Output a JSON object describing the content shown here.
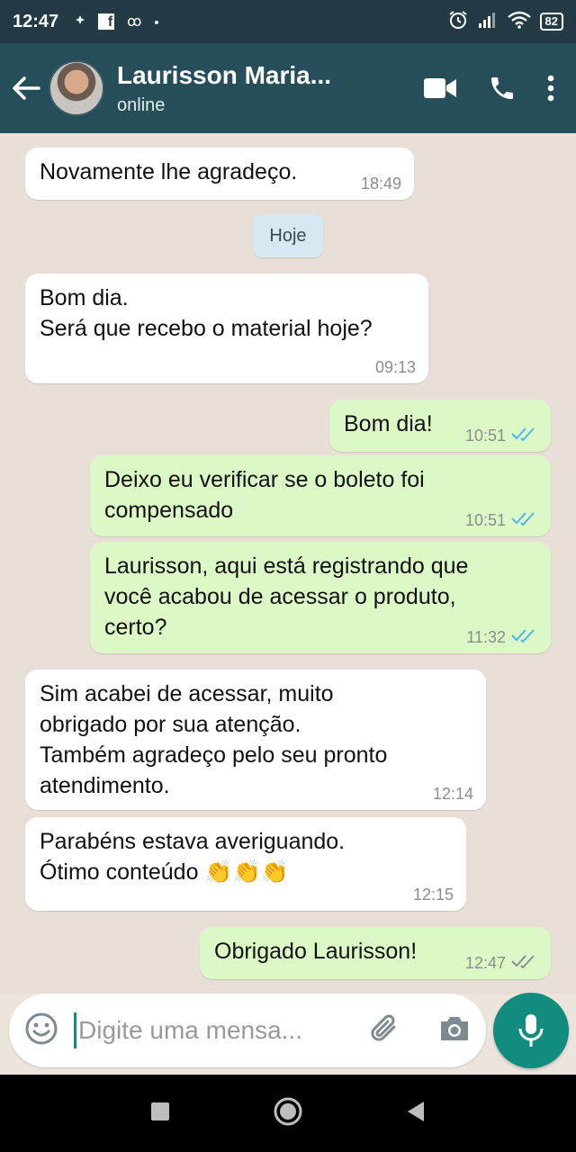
{
  "status_bar": {
    "time": "12:47",
    "facebook_glyph": "f",
    "voicemail_glyph": "ꝏ",
    "battery": "82",
    "icons": [
      "notification-dot-icon",
      "facebook-icon",
      "voicemail-icon",
      "alarm-icon",
      "signal-icon",
      "wifi-icon",
      "battery-icon"
    ]
  },
  "header": {
    "contact_name": "Laurisson Maria...",
    "contact_status": "online",
    "icons": [
      "back-arrow-icon",
      "avatar",
      "video-call-icon",
      "phone-call-icon",
      "more-options-icon"
    ]
  },
  "date_divider": "Hoje",
  "messages": [
    {
      "direction": "in",
      "lines": [
        "Novamente lhe agradeço."
      ],
      "time": "18:49",
      "read": false
    },
    {
      "direction": "in",
      "lines": [
        "Bom dia.",
        "Será que recebo o material hoje?"
      ],
      "time": "09:13",
      "read": false
    },
    {
      "direction": "out",
      "lines": [
        "Bom dia!"
      ],
      "time": "10:51",
      "read": true
    },
    {
      "direction": "out",
      "lines": [
        "Deixo eu verificar se o boleto foi",
        "compensado"
      ],
      "time": "10:51",
      "read": true
    },
    {
      "direction": "out",
      "lines": [
        "Laurisson, aqui está registrando que",
        "você acabou de acessar o produto,",
        "certo?"
      ],
      "time": "11:32",
      "read": true
    },
    {
      "direction": "in",
      "lines": [
        "Sim acabei de acessar, muito",
        "obrigado por sua atenção.",
        "Também agradeço pelo seu pronto",
        "atendimento."
      ],
      "time": "12:14",
      "read": false
    },
    {
      "direction": "in",
      "lines": [
        "Parabéns estava averiguando.",
        "Ótimo conteúdo 👏👏👏"
      ],
      "time": "12:15",
      "read": false
    },
    {
      "direction": "out",
      "lines": [
        "Obrigado Laurisson!"
      ],
      "time": "12:47",
      "read": false
    }
  ],
  "input": {
    "placeholder": "Digite uma mensa...",
    "icons": [
      "emoji-icon",
      "attach-icon",
      "camera-icon",
      "microphone-icon"
    ]
  },
  "colors": {
    "header": "#264d5a",
    "status_bar": "#233b44",
    "outgoing_bubble": "#dcf8c6",
    "incoming_bubble": "#ffffff",
    "chat_background": "#e8e0d6",
    "read_ticks": "#4fb6ec",
    "accent": "#128c7e"
  },
  "nav_bar": {
    "icons": [
      "recents-icon",
      "home-icon",
      "back-nav-icon"
    ]
  }
}
